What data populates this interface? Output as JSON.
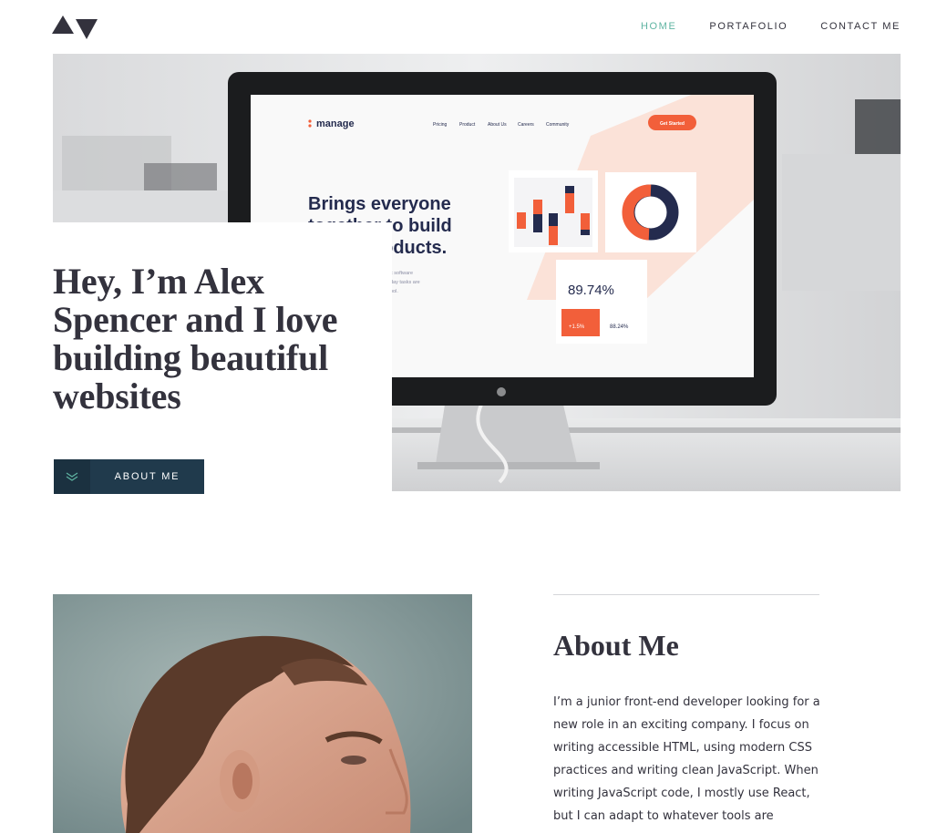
{
  "header": {
    "logo_icon": "logo-triangles-icon",
    "nav": [
      {
        "label": "HOME",
        "active": true
      },
      {
        "label": "PORTAFOLIO",
        "active": false
      },
      {
        "label": "CONTACT ME",
        "active": false
      }
    ]
  },
  "hero": {
    "title": "Hey, I’m Alex Spencer and I love building beautiful websites",
    "button_label": "ABOUT ME",
    "button_icon": "chevrons-down-icon",
    "screen": {
      "brand": "manage",
      "nav": [
        "Pricing",
        "Product",
        "About Us",
        "Careers",
        "Community"
      ],
      "cta": "Get Started",
      "headline_lines": [
        "Brings everyone",
        "together to build",
        "better products."
      ],
      "body_lines": [
        "x software",
        "day tasks are",
        "ool."
      ],
      "stat_main": "89.74%",
      "stat_change": "+1.5%",
      "stat_secondary": "88.24%"
    }
  },
  "about": {
    "title": "About Me",
    "text": "I’m a junior front-end developer looking for a new role in an exciting company. I focus on writing accessible HTML, using modern CSS practices and writing clean JavaScript. When writing JavaScript code, I mostly use React, but I can adapt to whatever tools are required. I’m"
  },
  "colors": {
    "dark": "#33323d",
    "accent": "#5fb4a2",
    "button": "#203a4c",
    "orange": "#f25f3a",
    "navy": "#242b4e"
  }
}
